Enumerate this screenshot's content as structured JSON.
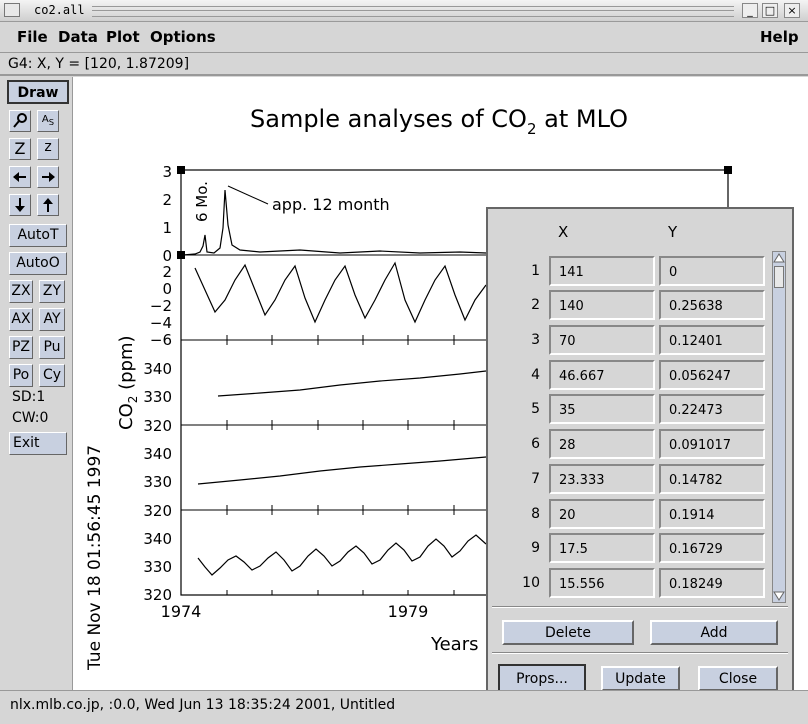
{
  "window": {
    "title": "co2.all",
    "min_glyph": "_",
    "max_glyph": "□",
    "close_glyph": "×"
  },
  "menubar": {
    "file": "File",
    "data": "Data",
    "plot": "Plot",
    "options": "Options",
    "help": "Help"
  },
  "status_line": "G4: X, Y = [120, 1.87209]",
  "toolbar": {
    "draw": "Draw",
    "zoom_big": "Z",
    "zoom_small": "z",
    "autot": "AutoT",
    "autoo": "AutoO",
    "zx": "ZX",
    "zy": "ZY",
    "ax": "AX",
    "ay": "AY",
    "pz": "PZ",
    "pu": "Pu",
    "po": "Po",
    "cy": "Cy",
    "sd": "SD:1",
    "cw": "CW:0",
    "exit": "Exit"
  },
  "plot": {
    "title_main": "Sample analyses of CO",
    "title_sub": "2",
    "title_end": " at MLO",
    "ylabel_main": "CO",
    "ylabel_sub": "2",
    "ylabel_end": " (ppm)",
    "xlabel": "Years",
    "timestamp": "Tue Nov 18 01:56:45 1997",
    "annotation_6mo": "6 Mo.",
    "annotation_12mo": "app. 12 month",
    "panel1_ticks": [
      "3",
      "2",
      "1",
      "0"
    ],
    "panel2_ticks": [
      "2",
      "0",
      "−2",
      "−4",
      "−6"
    ],
    "panel3_ticks": [
      "340",
      "330",
      "320"
    ],
    "panel4_ticks": [
      "340",
      "330",
      "320"
    ],
    "panel5_ticks": [
      "340",
      "330",
      "320"
    ],
    "x_ticks": [
      "1974",
      "1979"
    ]
  },
  "dialog": {
    "col_x": "X",
    "col_y": "Y",
    "rows": [
      {
        "n": "1",
        "x": "141",
        "y": "0"
      },
      {
        "n": "2",
        "x": "140",
        "y": "0.25638"
      },
      {
        "n": "3",
        "x": "70",
        "y": "0.12401"
      },
      {
        "n": "4",
        "x": "46.667",
        "y": "0.056247"
      },
      {
        "n": "5",
        "x": "35",
        "y": "0.22473"
      },
      {
        "n": "6",
        "x": "28",
        "y": "0.091017"
      },
      {
        "n": "7",
        "x": "23.333",
        "y": "0.14782"
      },
      {
        "n": "8",
        "x": "20",
        "y": "0.1914"
      },
      {
        "n": "9",
        "x": "17.5",
        "y": "0.16729"
      },
      {
        "n": "10",
        "x": "15.556",
        "y": "0.18249"
      }
    ],
    "delete": "Delete",
    "add": "Add",
    "props": "Props...",
    "update": "Update",
    "close": "Close"
  },
  "footer": "nlx.mlb.co.jp, :0.0, Wed Jun 13 18:35:24 2001, Untitled"
}
